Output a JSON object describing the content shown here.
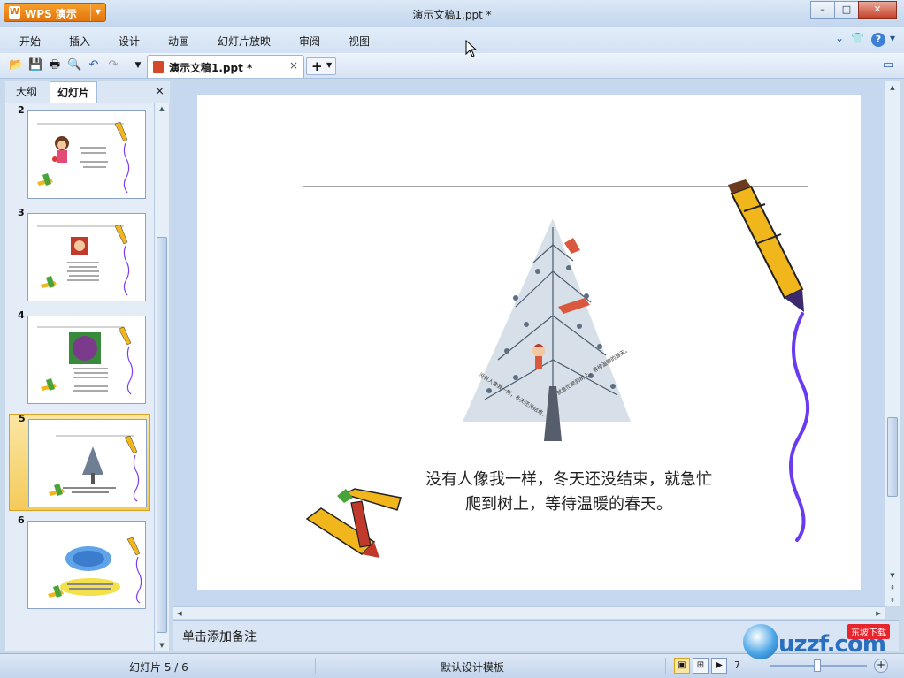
{
  "titlebar": {
    "app_name": "WPS 演示",
    "logo_glyph": "W",
    "doc_title": "演示文稿1.ppt *",
    "minimize": "–",
    "maximize": "□",
    "close": "✕"
  },
  "menu": {
    "items": [
      "开始",
      "插入",
      "设计",
      "动画",
      "幻灯片放映",
      "审阅",
      "视图"
    ],
    "help": "?",
    "skin_icon": "shirt-icon"
  },
  "toolbar": {
    "doc_tab_label": "演示文稿1.ppt *",
    "doc_tab_close": "×",
    "new_tab": "+"
  },
  "left_panel": {
    "tabs": [
      "大纲",
      "幻灯片"
    ],
    "close": "×",
    "thumbnails": [
      {
        "number": "2",
        "selected": false
      },
      {
        "number": "3",
        "selected": false
      },
      {
        "number": "4",
        "selected": false
      },
      {
        "number": "5",
        "selected": true
      },
      {
        "number": "6",
        "selected": false
      }
    ]
  },
  "slide": {
    "caption_line1": "没有人像我一样，冬天还没结束，就急忙",
    "caption_line2": "爬到树上，等待温暖的春天。"
  },
  "notes": {
    "placeholder": "单击添加备注"
  },
  "status": {
    "slide_count": "幻灯片 5 / 6",
    "template": "默认设计模板",
    "zoom": "7"
  },
  "watermark": {
    "brand": "uzzf.com",
    "tag": "东坡下载"
  },
  "colors": {
    "accent_orange": "#e2740c",
    "selected_thumb": "#f4cb5a",
    "panel_blue": "#c6d8ef"
  }
}
